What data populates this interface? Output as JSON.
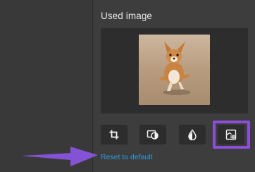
{
  "panel": {
    "title": "Used image",
    "reset_label": "Reset to default"
  },
  "tools": [
    {
      "name": "crop",
      "icon": "crop-icon"
    },
    {
      "name": "replace-image",
      "icon": "image-replace-icon"
    },
    {
      "name": "color",
      "icon": "droplet-icon"
    },
    {
      "name": "filters",
      "icon": "image-filter-icon",
      "selected": true
    }
  ],
  "colors": {
    "accent": "#8b4fd7",
    "link": "#2d9de0",
    "panel_bg": "#3d3d3d",
    "tile_bg": "#2d2d2d"
  }
}
